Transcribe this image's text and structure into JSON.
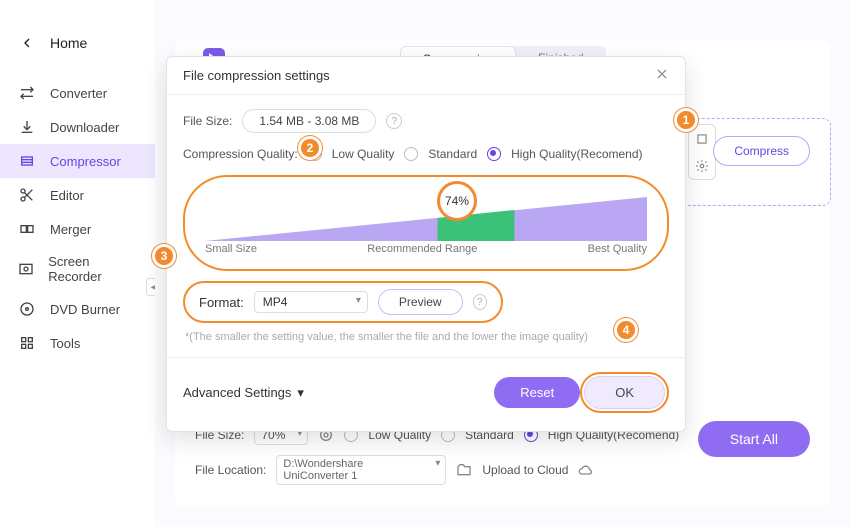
{
  "sidebar": {
    "home": "Home",
    "items": [
      {
        "label": "Converter"
      },
      {
        "label": "Downloader"
      },
      {
        "label": "Compressor"
      },
      {
        "label": "Editor"
      },
      {
        "label": "Merger"
      },
      {
        "label": "Screen Recorder"
      },
      {
        "label": "DVD Burner"
      },
      {
        "label": "Tools"
      }
    ]
  },
  "main": {
    "tabs": {
      "compressing": "Compressing",
      "finished": "Finished"
    },
    "compress_btn": "Compress",
    "bottom": {
      "filesize_label": "File Size:",
      "filesize_value": "70%",
      "low": "Low Quality",
      "standard": "Standard",
      "high": "High Quality(Recomend)",
      "location_label": "File Location:",
      "location_value": "D:\\Wondershare UniConverter 1",
      "upload": "Upload to Cloud",
      "start_all": "Start All"
    }
  },
  "dialog": {
    "title": "File compression settings",
    "filesize_label": "File Size:",
    "filesize_value": "1.54 MB - 3.08 MB",
    "quality_label": "Compression Quality:",
    "q_low": "Low Quality",
    "q_std": "Standard",
    "q_high": "High Quality(Recomend)",
    "slider": {
      "small": "Small Size",
      "rec": "Recommended Range",
      "best": "Best Quality",
      "value": "74%"
    },
    "format_label": "Format:",
    "format_value": "MP4",
    "preview": "Preview",
    "note": "*(The smaller the setting value, the smaller the file and the lower the image quality)",
    "advanced": "Advanced Settings",
    "reset": "Reset",
    "ok": "OK"
  },
  "callouts": {
    "c1": "1",
    "c2": "2",
    "c3": "3",
    "c4": "4"
  }
}
